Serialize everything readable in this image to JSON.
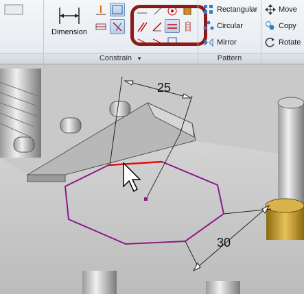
{
  "ribbon": {
    "dimension_label": "Dimension",
    "constrain_title": "Constrain",
    "constrain_dropdown_icon": "triangle-down-icon",
    "pattern_title": "Pattern",
    "pattern": {
      "rectangular": "Rectangular",
      "circular": "Circular",
      "mirror": "Mirror"
    },
    "modify": {
      "move": "Move",
      "copy": "Copy",
      "rotate": "Rotate"
    }
  },
  "viewport": {
    "dim_top": "25",
    "dim_right": "30"
  },
  "colors": {
    "highlight": "#8c1a1a",
    "octagon": "#8a1a8a",
    "selected_edge": "#e01010",
    "model": "#bdbdbd"
  }
}
